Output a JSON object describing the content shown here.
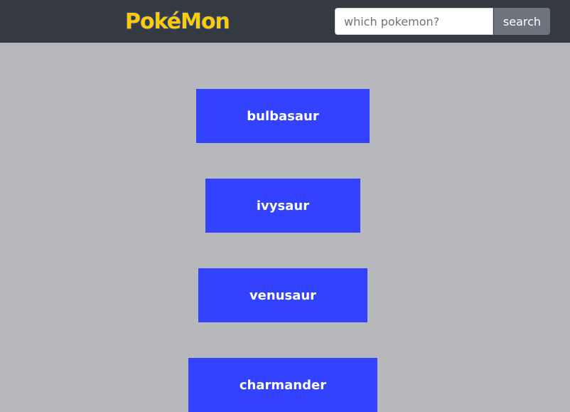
{
  "navbar": {
    "logo_text": "PokéMon"
  },
  "search": {
    "placeholder": "which pokemon?",
    "button_label": "search"
  },
  "pokemon_list": [
    "bulbasaur",
    "ivysaur",
    "venusaur",
    "charmander"
  ],
  "colors": {
    "navbar_bg": "#343a40",
    "page_bg": "#b7b8bb",
    "card_bg": "#3342ff",
    "card_text": "#ffffff",
    "button_bg": "#6c757d",
    "logo_yellow": "#ffcb05",
    "logo_blue": "#2a4d9b"
  }
}
